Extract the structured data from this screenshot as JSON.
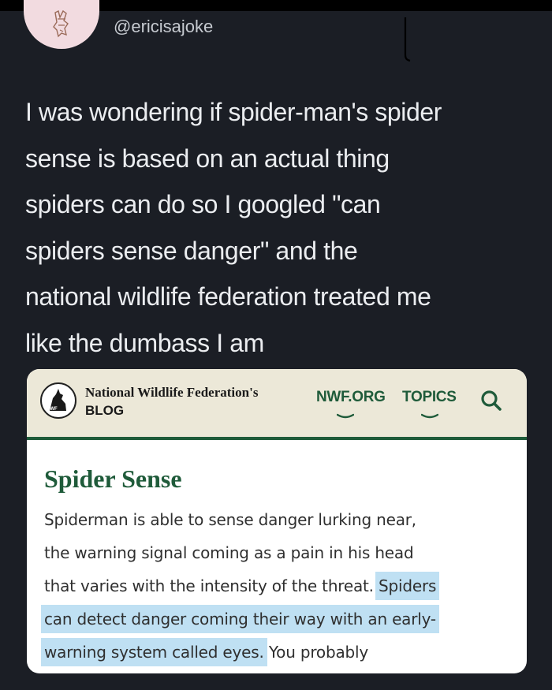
{
  "tweet": {
    "handle": "@ericisajoke",
    "lines": [
      "I was wondering if spider-man's spider",
      "sense is based on an actual thing",
      "spiders can do so I googled \"can",
      "spiders sense danger\" and the",
      "national wildlife federation treated me",
      "like the dumbass I am"
    ]
  },
  "embed": {
    "brand_title": "National Wildlife Federation's",
    "brand_sub": "BLOG",
    "nav": [
      "NWF.ORG",
      "TOPICS"
    ],
    "article_title": "Spider Sense",
    "body": {
      "line1": "Spiderman is able to sense danger lurking near,",
      "line2": "the warning signal coming as a pain in his head",
      "line3_plain": "that varies with the intensity of the threat. ",
      "line3_hl": "Spiders",
      "line4_hl": "can detect danger coming their way with an early-",
      "line5_hl": "warning system called eyes.",
      "line5_plain": " You probably"
    },
    "highlight_color": "#bfe0f3",
    "accent_color": "#1f5b3a"
  },
  "icons": {
    "avatar": "avatar-illustration",
    "logo": "nwf-logo-icon",
    "search": "search-icon"
  }
}
